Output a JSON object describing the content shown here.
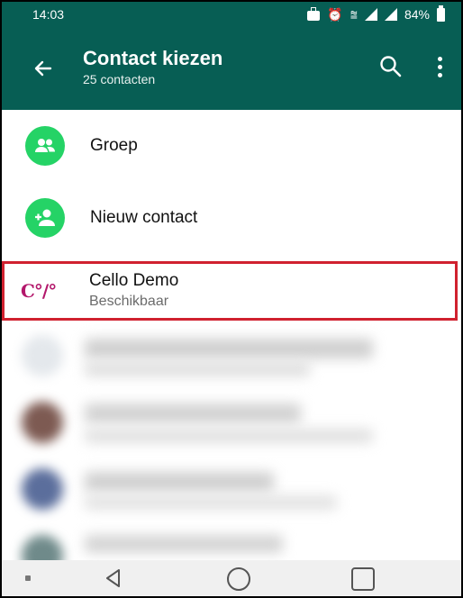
{
  "status_bar": {
    "time": "14:03",
    "alarm_glyph": "⏰",
    "wifi_glyph": "⩰",
    "battery": "84%",
    "icons": [
      "briefcase-icon",
      "alarm-icon",
      "wifi-icon",
      "signal-icon",
      "signal-icon",
      "battery-icon"
    ]
  },
  "app_bar": {
    "title": "Contact kiezen",
    "subtitle": "25 contacten",
    "icons": [
      "back-arrow-icon",
      "search-icon",
      "more-vert-icon"
    ]
  },
  "list": {
    "actions": [
      {
        "label": "Groep",
        "icon": "group-icon"
      },
      {
        "label": "Nieuw contact",
        "icon": "add-contact-icon"
      }
    ],
    "highlighted_contact": {
      "name": "Cello Demo",
      "status": "Beschikbaar",
      "logo_text": "C°/°"
    }
  },
  "colors": {
    "header": "#075e54",
    "accent_green": "#25d366",
    "highlight_border": "#d0212f",
    "logo": "#b3176b"
  },
  "nav_bar": {
    "icons": [
      "nav-dot-icon",
      "nav-back-icon",
      "nav-home-icon",
      "nav-recents-icon"
    ]
  }
}
